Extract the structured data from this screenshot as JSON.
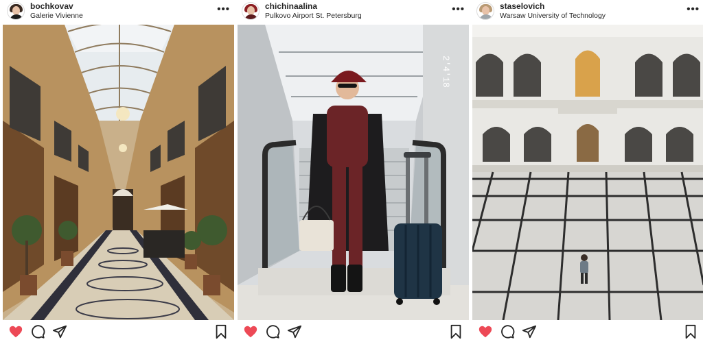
{
  "posts": [
    {
      "username": "bochkovav",
      "location": "Galerie Vivienne",
      "more_label": "•••",
      "liked": true,
      "photo_overlay_text": "",
      "icons": [
        "avatar",
        "more-icon",
        "heart-icon",
        "comment-icon",
        "share-icon",
        "bookmark-icon"
      ]
    },
    {
      "username": "chichinaalina",
      "location": "Pulkovo Airport St. Petersburg",
      "more_label": "•••",
      "liked": true,
      "photo_overlay_text": "2'4'18",
      "icons": [
        "avatar",
        "more-icon",
        "heart-icon",
        "comment-icon",
        "share-icon",
        "bookmark-icon"
      ]
    },
    {
      "username": "staselovich",
      "location": "Warsaw University of Technology",
      "more_label": "•••",
      "liked": true,
      "photo_overlay_text": "",
      "icons": [
        "avatar",
        "more-icon",
        "heart-icon",
        "comment-icon",
        "share-icon",
        "bookmark-icon"
      ]
    }
  ],
  "colors": {
    "like_red": "#ed4956",
    "icon_dark": "#262626",
    "text_dark": "#262626",
    "border": "#dbdbdb"
  }
}
